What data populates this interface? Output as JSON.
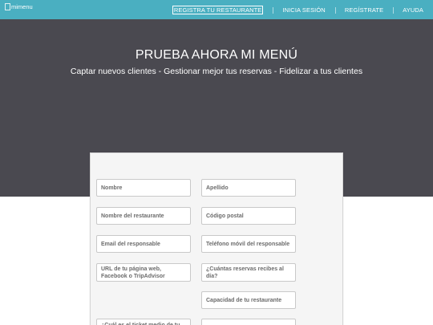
{
  "navbar": {
    "logo_text": "mimenu",
    "items": [
      {
        "label": "REGISTRA TU RESTAURANTE",
        "active": true
      },
      {
        "label": "INICIA SESIÓN",
        "active": false
      },
      {
        "label": "REGÍSTRATE",
        "active": false
      },
      {
        "label": "AYUDA",
        "active": false
      }
    ]
  },
  "hero": {
    "title": "PRUEBA AHORA MI MENÚ",
    "subtitle": "Captar nuevos clientes - Gestionar mejor tus reservas - Fidelizar a tus clientes"
  },
  "form": {
    "nombre": "Nombre",
    "apellido": "Apellido",
    "nombre_restaurante": "Nombre del restaurante",
    "codigo_postal": "Código postal",
    "email": "Email del responsable",
    "telefono": "Teléfono móvil del responsable",
    "url": "URL de tu página web, Facebook o TripAdvisor",
    "reservas": "¿Cuántas reservas recibes al día?",
    "capacidad": "Capacidad de tu restaurante",
    "ticket": "¿Cuál es el ticket medio de tu"
  },
  "colors": {
    "navbar": "#4aafc1",
    "hero": "#4a4950",
    "card": "#f5f5f5"
  }
}
